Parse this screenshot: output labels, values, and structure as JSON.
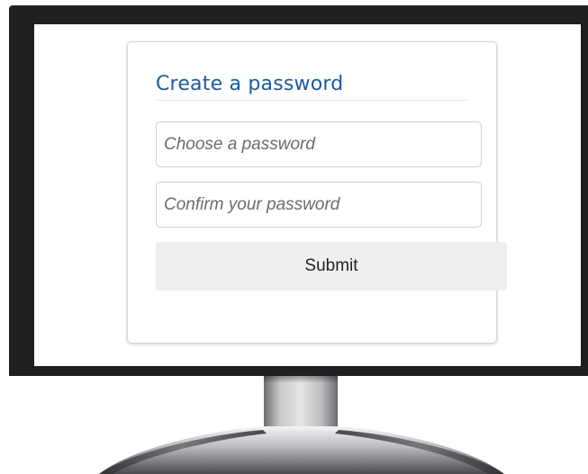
{
  "form": {
    "title": "Create a password",
    "password_placeholder": "Choose a password",
    "confirm_placeholder": "Confirm your password",
    "submit_label": "Submit"
  },
  "colors": {
    "title": "#1c5a9e",
    "bezel": "#1f1f21",
    "button_bg": "#efefef"
  }
}
